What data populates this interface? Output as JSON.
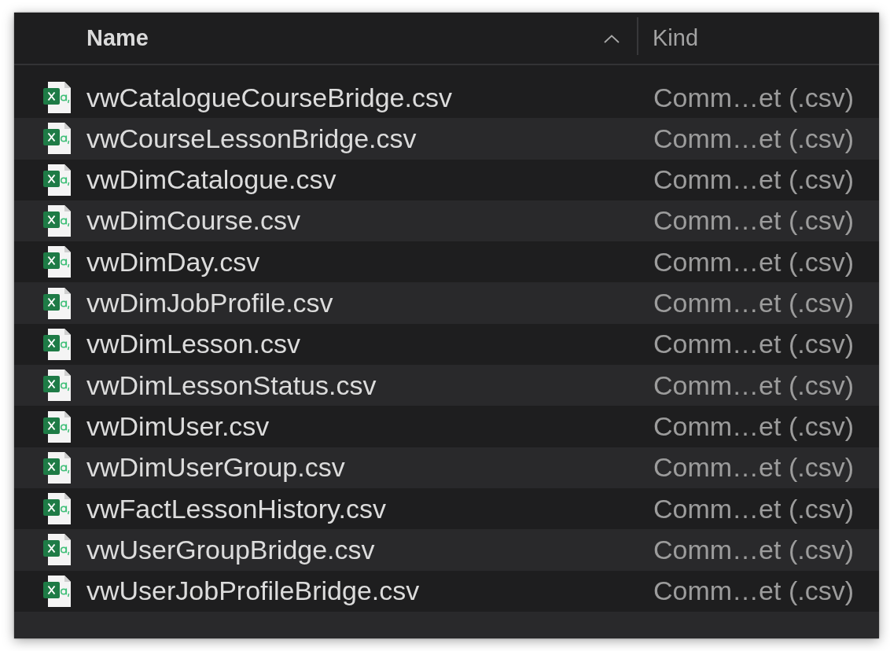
{
  "columns": [
    {
      "label": "Name",
      "sorted": true
    },
    {
      "label": "Kind",
      "sorted": false
    }
  ],
  "files": [
    {
      "name": "vwCatalogueCourseBridge.csv",
      "kind": "Comm…et (.csv)",
      "selected": false
    },
    {
      "name": "vwCourseLessonBridge.csv",
      "kind": "Comm…et (.csv)",
      "selected": false
    },
    {
      "name": "vwDimCatalogue.csv",
      "kind": "Comm…et (.csv)",
      "selected": false
    },
    {
      "name": "vwDimCourse.csv",
      "kind": "Comm…et (.csv)",
      "selected": false
    },
    {
      "name": "vwDimDay.csv",
      "kind": "Comm…et (.csv)",
      "selected": false
    },
    {
      "name": "vwDimJobProfile.csv",
      "kind": "Comm…et (.csv)",
      "selected": false
    },
    {
      "name": "vwDimLesson.csv",
      "kind": "Comm…et (.csv)",
      "selected": false
    },
    {
      "name": "vwDimLessonStatus.csv",
      "kind": "Comm…et (.csv)",
      "selected": false
    },
    {
      "name": "vwDimUser.csv",
      "kind": "Comm…et (.csv)",
      "selected": false
    },
    {
      "name": "vwDimUserGroup.csv",
      "kind": "Comm…et (.csv)",
      "selected": false
    },
    {
      "name": "vwFactLessonHistory.csv",
      "kind": "Comm…et (.csv)",
      "selected": false
    },
    {
      "name": "vwUserGroupBridge.csv",
      "kind": "Comm…et (.csv)",
      "selected": false
    },
    {
      "name": "vwUserJobProfileBridge.csv",
      "kind": "Comm…et (.csv)",
      "selected": false
    }
  ]
}
